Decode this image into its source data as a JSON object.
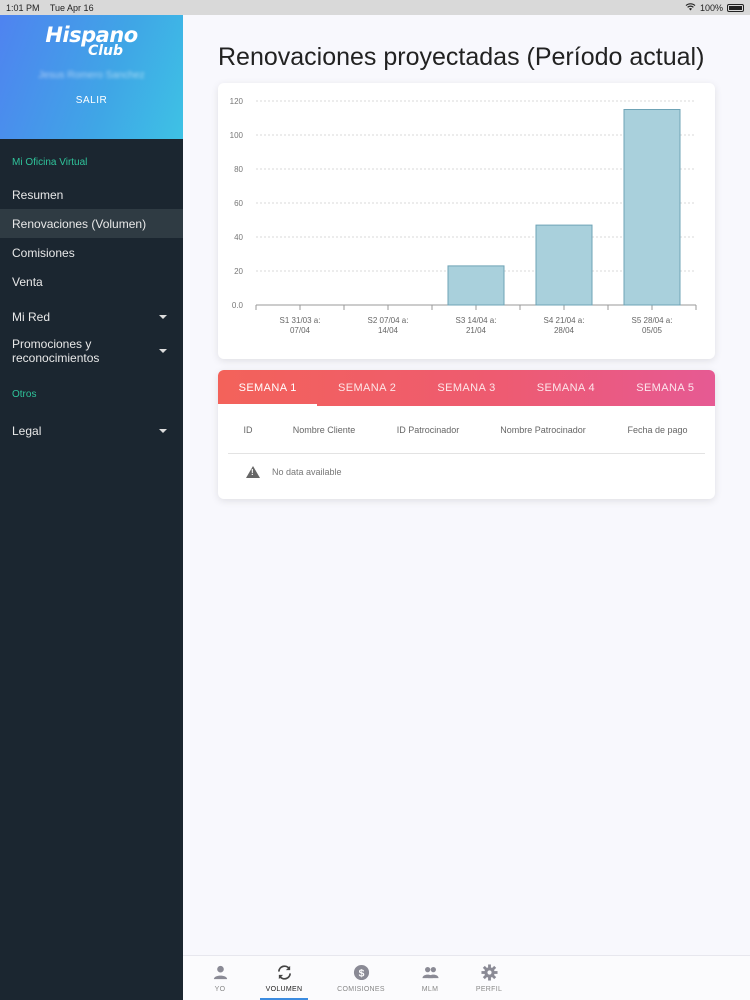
{
  "status_bar": {
    "time": "1:01 PM",
    "date": "Tue Apr 16",
    "battery": "100%"
  },
  "sidebar": {
    "logo_line1": "Hispano",
    "logo_line2": "Club",
    "user_name": "Jesus Romero Sanchez",
    "logout": "SALIR",
    "section_main": "Mi Oficina Virtual",
    "items": [
      {
        "label": "Resumen"
      },
      {
        "label": "Renovaciones (Volumen)"
      },
      {
        "label": "Comisiones"
      },
      {
        "label": "Venta"
      },
      {
        "label": "Mi Red"
      },
      {
        "label": "Promociones y reconocimientos"
      }
    ],
    "section_other": "Otros",
    "legal": "Legal"
  },
  "main": {
    "title": "Renovaciones proyectadas (Período actual)",
    "tabs": [
      {
        "label": "SEMANA 1"
      },
      {
        "label": "SEMANA 2"
      },
      {
        "label": "SEMANA 3"
      },
      {
        "label": "SEMANA 4"
      },
      {
        "label": "SEMANA 5"
      }
    ],
    "table": {
      "columns": [
        "ID",
        "Nombre Cliente",
        "ID Patrocinador",
        "Nombre Patrocinador",
        "Fecha de pago"
      ],
      "empty_message": "No data available"
    }
  },
  "bottom_nav": [
    {
      "label": "YO",
      "icon": "person-icon"
    },
    {
      "label": "VOLUMEN",
      "icon": "refresh-icon"
    },
    {
      "label": "COMISIONES",
      "icon": "dollar-icon"
    },
    {
      "label": "MLM",
      "icon": "group-icon"
    },
    {
      "label": "PERFIL",
      "icon": "gear-icon"
    }
  ],
  "colors": {
    "sidebar_bg": "#1b2630",
    "accent_green": "#2fc39a",
    "bar_fill": "#a9d0dc",
    "bar_stroke": "#6ea3b6",
    "tabbar_start": "#f3625a",
    "tabbar_end": "#e65a93",
    "active_nav": "#3b8be0"
  },
  "chart_data": {
    "type": "bar",
    "categories": [
      [
        "S1 31/03 a:",
        "07/04"
      ],
      [
        "S2 07/04 a:",
        "14/04"
      ],
      [
        "S3 14/04 a:",
        "21/04"
      ],
      [
        "S4 21/04 a:",
        "28/04"
      ],
      [
        "S5 28/04 a:",
        "05/05"
      ]
    ],
    "values": [
      0,
      0,
      23,
      47,
      115
    ],
    "y_ticks": [
      "0.0",
      "20",
      "40",
      "60",
      "80",
      "100",
      "120"
    ],
    "ylim": [
      0,
      120
    ],
    "grid": true,
    "title": "",
    "xlabel": "",
    "ylabel": ""
  }
}
